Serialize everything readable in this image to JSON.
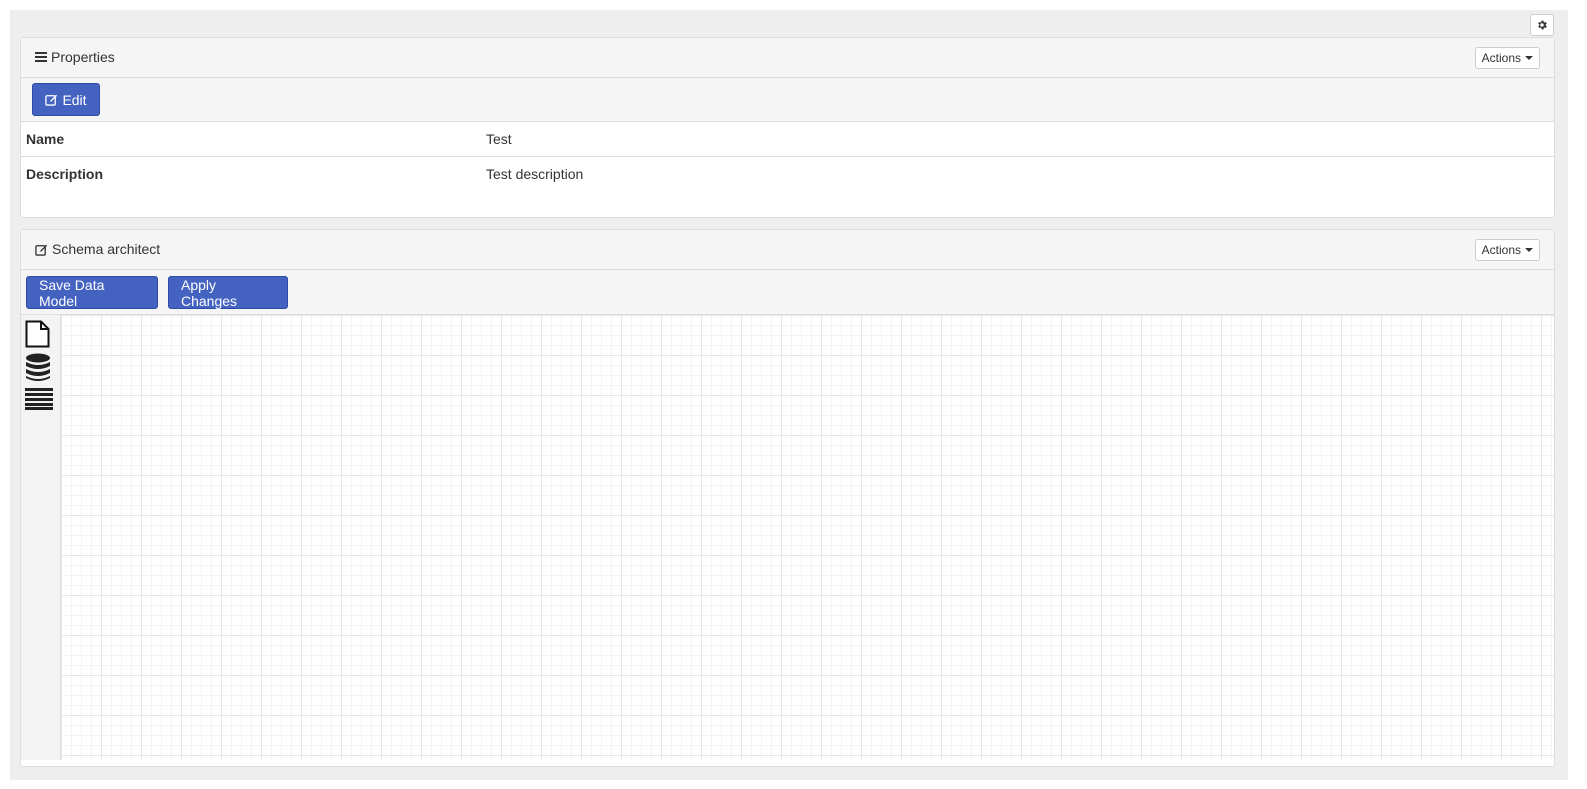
{
  "toolbar": {
    "settings_icon": "gear-icon"
  },
  "properties": {
    "title": "Properties",
    "title_icon": "bars-icon",
    "actions_label": "Actions",
    "edit_label": "Edit",
    "edit_icon": "edit-icon",
    "rows": [
      {
        "key": "Name",
        "value": "Test"
      },
      {
        "key": "Description",
        "value": "Test description"
      }
    ]
  },
  "schema": {
    "title": "Schema architect",
    "title_icon": "edit-icon",
    "actions_label": "Actions",
    "save_label": "Save Data Model",
    "apply_label": "Apply Changes",
    "palette": [
      "file-icon",
      "database-icon",
      "table-icon"
    ]
  },
  "colors": {
    "primary": "#4462c0",
    "panel_heading": "#f5f5f5",
    "page_bg": "#eeeeee"
  }
}
